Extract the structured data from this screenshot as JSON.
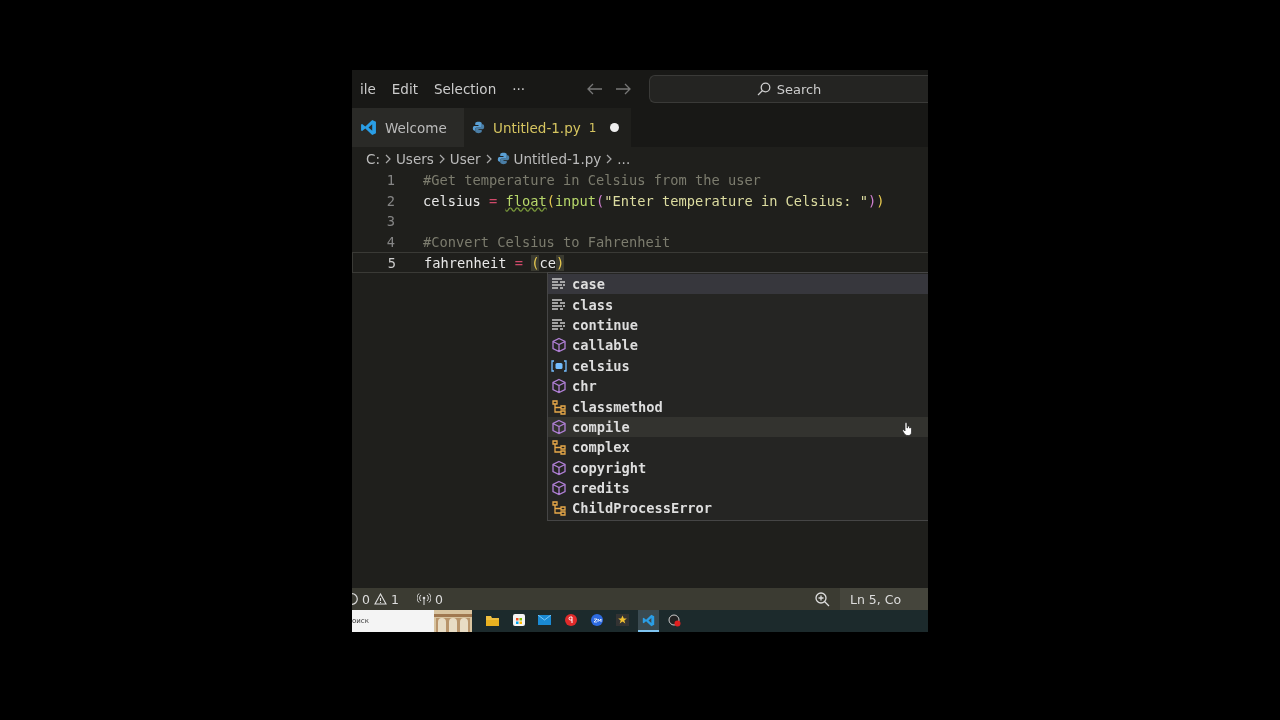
{
  "menu": [
    "ile",
    "Edit",
    "Selection",
    "···"
  ],
  "search": {
    "placeholder": "Search"
  },
  "tabs": [
    {
      "label": "Welcome",
      "kind": "vscode",
      "selected": false,
      "modified": false
    },
    {
      "label": "Untitled-1.py",
      "kind": "python",
      "badge": "1",
      "selected": true,
      "modified": true
    }
  ],
  "breadcrumb": [
    {
      "label": "C:",
      "kind": "text"
    },
    {
      "label": "Users",
      "kind": "text"
    },
    {
      "label": "User",
      "kind": "text"
    },
    {
      "label": "Untitled-1.py",
      "kind": "python"
    },
    {
      "label": "...",
      "kind": "text"
    }
  ],
  "code": [
    {
      "number": "1",
      "current": false,
      "tokens": [
        {
          "text": "#Get temperature in Celsius from the user",
          "kind": "comment"
        }
      ]
    },
    {
      "number": "2",
      "current": false,
      "tokens": [
        {
          "text": "celsius",
          "kind": "variable"
        },
        {
          "text": " = ",
          "kind": "operator"
        },
        {
          "text": "float",
          "kind": "function"
        },
        {
          "text": "(",
          "kind": "paren"
        },
        {
          "text": "input",
          "kind": "function"
        },
        {
          "text": "(",
          "kind": "paren2"
        },
        {
          "text": "\"Enter temperature in Celsius: \"",
          "kind": "string"
        },
        {
          "text": ")",
          "kind": "paren2"
        },
        {
          "text": ")",
          "kind": "paren"
        }
      ]
    },
    {
      "number": "3",
      "current": false
    },
    {
      "number": "4",
      "current": false,
      "tokens": [
        {
          "text": "#Convert Celsius to Fahrenheit",
          "kind": "comment"
        }
      ]
    },
    {
      "number": "5",
      "current": true,
      "tokens": [
        {
          "text": "fahrenheit",
          "kind": "variable"
        },
        {
          "text": " = ",
          "kind": "operator"
        },
        {
          "text": "(",
          "kind": "paren"
        },
        {
          "text": "ce",
          "kind": "typing"
        },
        {
          "text": ")",
          "kind": "paren"
        }
      ]
    }
  ],
  "suggestions": [
    {
      "label": "case",
      "kind": "keyword",
      "selected": true,
      "hovered": false
    },
    {
      "label": "class",
      "kind": "keyword",
      "selected": false,
      "hovered": false
    },
    {
      "label": "continue",
      "kind": "keyword",
      "selected": false,
      "hovered": false
    },
    {
      "label": "callable",
      "kind": "function",
      "selected": false,
      "hovered": false
    },
    {
      "label": "celsius",
      "kind": "variable",
      "selected": false,
      "hovered": false
    },
    {
      "label": "chr",
      "kind": "function",
      "selected": false,
      "hovered": false
    },
    {
      "label": "classmethod",
      "kind": "class",
      "selected": false,
      "hovered": false
    },
    {
      "label": "compile",
      "kind": "function",
      "selected": false,
      "hovered": true
    },
    {
      "label": "complex",
      "kind": "class",
      "selected": false,
      "hovered": false
    },
    {
      "label": "copyright",
      "kind": "function",
      "selected": false,
      "hovered": false
    },
    {
      "label": "credits",
      "kind": "function",
      "selected": false,
      "hovered": false
    },
    {
      "label": "ChildProcessError",
      "kind": "class",
      "selected": false,
      "hovered": false
    }
  ],
  "status_bar": {
    "errors": "0",
    "warnings": "1",
    "ports": "0",
    "position": "Ln 5, Co"
  },
  "taskbar": {
    "search": "оиск",
    "apps": [
      {
        "kind": "folder",
        "active": false
      },
      {
        "kind": "store",
        "active": false
      },
      {
        "kind": "mail",
        "active": false
      },
      {
        "kind": "browser",
        "active": false
      },
      {
        "kind": "meeting",
        "active": false
      },
      {
        "kind": "movie",
        "active": false
      },
      {
        "kind": "vscode",
        "active": true
      },
      {
        "kind": "recorder",
        "active": false
      }
    ]
  }
}
